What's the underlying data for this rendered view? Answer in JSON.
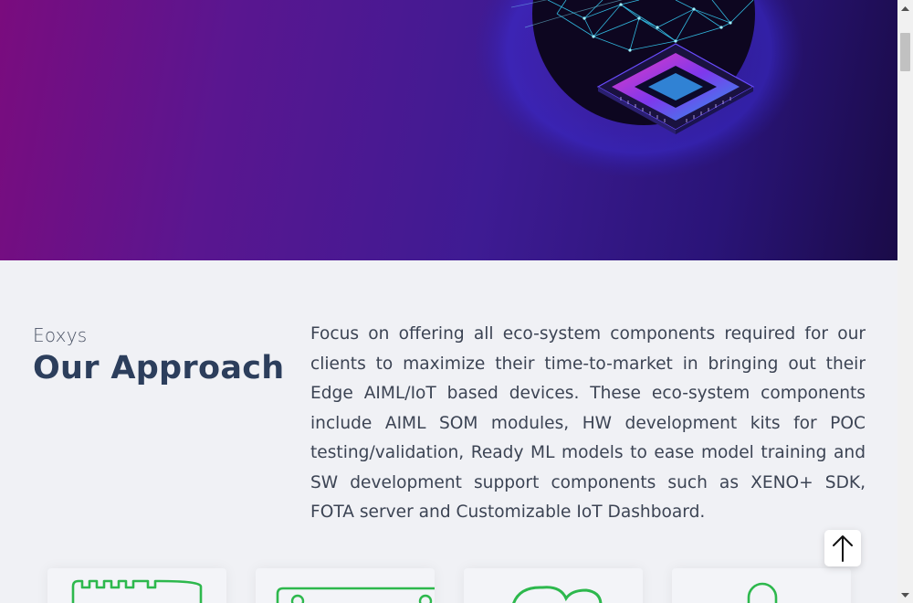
{
  "approach": {
    "eyebrow": "Eoxys",
    "heading": "Our Approach",
    "body": "Focus on offering all eco-system components required for our clients to maximize their time-to-market in bringing out their Edge AIML/IoT based devices. These eco-system components include AIML SOM modules, HW development kits for POC testing/validation, Ready ML models to ease model training and SW development support components such as XENO+ SDK, FOTA server and Customizable IoT Dashboard."
  },
  "cards": [
    {
      "icon": "chip-module-icon"
    },
    {
      "icon": "dev-board-icon"
    },
    {
      "icon": "cloud-icon"
    },
    {
      "icon": "user-icon"
    }
  ],
  "colors": {
    "hero_start": "#7a0c7e",
    "hero_end": "#1a0b48",
    "heading": "#2c3e5c",
    "accent_green": "#2db84d",
    "background": "#f0f1f5"
  },
  "icons": {
    "hero": "ai-chip-globe-illustration",
    "back_to_top": "arrow-up-icon",
    "scroll_up": "scroll-up-arrow-icon",
    "scroll_down": "scroll-down-arrow-icon"
  }
}
